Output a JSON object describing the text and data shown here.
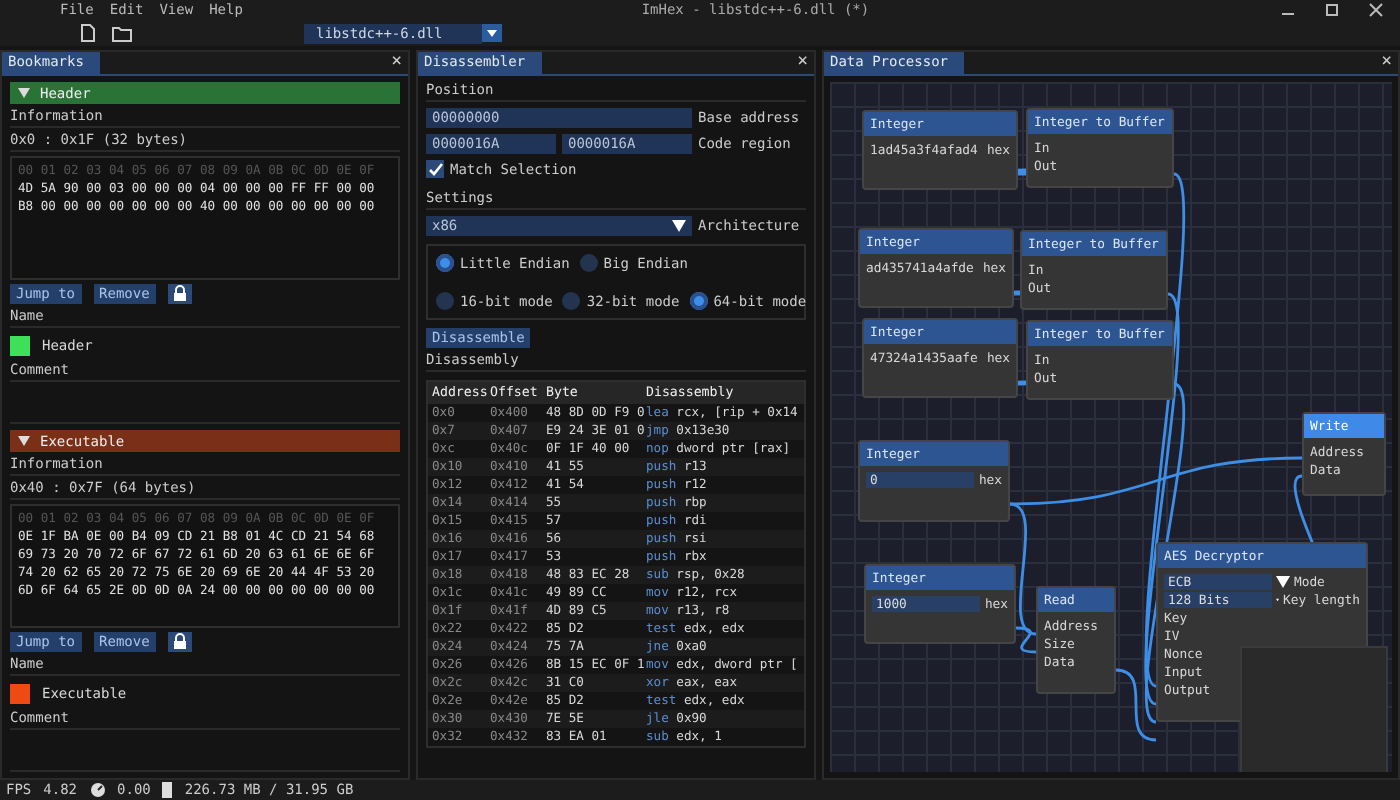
{
  "menu": [
    "File",
    "Edit",
    "View",
    "Help"
  ],
  "window_title": "ImHex - libstdc++-6.dll (*)",
  "file_tab": "libstdc++-6.dll",
  "bookmarks_panel": {
    "title": "Bookmarks",
    "close": "×",
    "bookmarks": [
      {
        "title": "Header",
        "name": "Header",
        "color": "#3ee05a",
        "info_label": "Information",
        "range": "0x0 : 0x1F (32 bytes)",
        "byte_header": "00 01 02 03 04 05 06 07 08 09 0A 0B 0C 0D 0E 0F",
        "byte_rows": [
          "4D 5A 90 00 03 00 00 00 04 00 00 00 FF FF 00 00",
          "B8 00 00 00 00 00 00 00 40 00 00 00 00 00 00 00"
        ],
        "buttons": [
          "Jump to",
          "Remove"
        ],
        "name_label": "Name",
        "comment_label": "Comment"
      },
      {
        "title": "Executable",
        "name": "Executable",
        "color": "#f04a14",
        "info_label": "Information",
        "range": "0x40 : 0x7F (64 bytes)",
        "byte_header": "00 01 02 03 04 05 06 07 08 09 0A 0B 0C 0D 0E 0F",
        "byte_rows": [
          "0E 1F BA 0E 00 B4 09 CD 21 B8 01 4C CD 21 54 68",
          "69 73 20 70 72 6F 67 72 61 6D 20 63 61 6E 6E 6F",
          "74 20 62 65 20 72 75 6E 20 69 6E 20 44 4F 53 20",
          "6D 6F 64 65 2E 0D 0D 0A 24 00 00 00 00 00 00 00"
        ],
        "buttons": [
          "Jump to",
          "Remove"
        ],
        "name_label": "Name",
        "comment_label": "Comment"
      }
    ]
  },
  "disassembler": {
    "title": "Disassembler",
    "close": "×",
    "position_label": "Position",
    "base_address": "00000000",
    "base_address_label": "Base address",
    "code_region": [
      "0000016A",
      "0000016A"
    ],
    "code_region_label": "Code region",
    "match_selection": {
      "label": "Match Selection",
      "checked": true
    },
    "settings_label": "Settings",
    "architecture": {
      "value": "x86",
      "label": "Architecture"
    },
    "endian": [
      {
        "label": "Little Endian",
        "selected": true
      },
      {
        "label": "Big Endian",
        "selected": false
      }
    ],
    "modes": [
      {
        "label": "16-bit mode",
        "selected": false
      },
      {
        "label": "32-bit mode",
        "selected": false
      },
      {
        "label": "64-bit mode",
        "selected": true
      }
    ],
    "disassemble_button": "Disassemble",
    "disassembly_label": "Disassembly",
    "table": {
      "columns": [
        "Address",
        "Offset",
        "Byte",
        "Disassembly"
      ],
      "rows": [
        {
          "address": "0x0",
          "offset": "0x400",
          "bytes": "48 8D 0D F9 0",
          "mnemonic": "lea",
          "operands": "rcx, [rip + 0x14"
        },
        {
          "address": "0x7",
          "offset": "0x407",
          "bytes": "E9 24 3E 01 0",
          "mnemonic": "jmp",
          "operands": "0x13e30"
        },
        {
          "address": "0xc",
          "offset": "0x40c",
          "bytes": "0F 1F 40 00",
          "mnemonic": "nop",
          "operands": "dword ptr [rax]"
        },
        {
          "address": "0x10",
          "offset": "0x410",
          "bytes": "41 55",
          "mnemonic": "push",
          "operands": "r13"
        },
        {
          "address": "0x12",
          "offset": "0x412",
          "bytes": "41 54",
          "mnemonic": "push",
          "operands": "r12"
        },
        {
          "address": "0x14",
          "offset": "0x414",
          "bytes": "55",
          "mnemonic": "push",
          "operands": "rbp"
        },
        {
          "address": "0x15",
          "offset": "0x415",
          "bytes": "57",
          "mnemonic": "push",
          "operands": "rdi"
        },
        {
          "address": "0x16",
          "offset": "0x416",
          "bytes": "56",
          "mnemonic": "push",
          "operands": "rsi"
        },
        {
          "address": "0x17",
          "offset": "0x417",
          "bytes": "53",
          "mnemonic": "push",
          "operands": "rbx"
        },
        {
          "address": "0x18",
          "offset": "0x418",
          "bytes": "48 83 EC 28",
          "mnemonic": "sub",
          "operands": "rsp, 0x28"
        },
        {
          "address": "0x1c",
          "offset": "0x41c",
          "bytes": "49 89 CC",
          "mnemonic": "mov",
          "operands": "r12, rcx"
        },
        {
          "address": "0x1f",
          "offset": "0x41f",
          "bytes": "4D 89 C5",
          "mnemonic": "mov",
          "operands": "r13, r8"
        },
        {
          "address": "0x22",
          "offset": "0x422",
          "bytes": "85 D2",
          "mnemonic": "test",
          "operands": "edx, edx"
        },
        {
          "address": "0x24",
          "offset": "0x424",
          "bytes": "75 7A",
          "mnemonic": "jne",
          "operands": "0xa0"
        },
        {
          "address": "0x26",
          "offset": "0x426",
          "bytes": "8B 15 EC 0F 1",
          "mnemonic": "mov",
          "operands": "edx, dword ptr ["
        },
        {
          "address": "0x2c",
          "offset": "0x42c",
          "bytes": "31 C0",
          "mnemonic": "xor",
          "operands": "eax, eax"
        },
        {
          "address": "0x2e",
          "offset": "0x42e",
          "bytes": "85 D2",
          "mnemonic": "test",
          "operands": "edx, edx"
        },
        {
          "address": "0x30",
          "offset": "0x430",
          "bytes": "7E 5E",
          "mnemonic": "jle",
          "operands": "0x90"
        },
        {
          "address": "0x32",
          "offset": "0x432",
          "bytes": "83 EA 01",
          "mnemonic": "sub",
          "operands": "edx, 1"
        }
      ]
    }
  },
  "data_processor": {
    "title": "Data Processor",
    "close": "×",
    "nodes": [
      {
        "kind": "integer",
        "title": "Integer",
        "value": "1ad45a3f4afad4",
        "unit": "hex",
        "selected": false
      },
      {
        "kind": "int_to_buffer",
        "title": "Integer to Buffer",
        "pins": [
          "In",
          "Out"
        ],
        "selected": false
      },
      {
        "kind": "integer",
        "title": "Integer",
        "value": "ad435741a4afde",
        "unit": "hex",
        "selected": false
      },
      {
        "kind": "int_to_buffer",
        "title": "Integer to Buffer",
        "pins": [
          "In",
          "Out"
        ],
        "selected": false
      },
      {
        "kind": "integer",
        "title": "Integer",
        "value": "47324a1435aafe",
        "unit": "hex",
        "selected": false
      },
      {
        "kind": "int_to_buffer",
        "title": "Integer to Buffer",
        "pins": [
          "In",
          "Out"
        ],
        "selected": false
      },
      {
        "kind": "integer_input",
        "title": "Integer",
        "value": "0",
        "unit": "hex",
        "selected": false
      },
      {
        "kind": "integer_input",
        "title": "Integer",
        "value": "1000",
        "unit": "hex",
        "selected": false
      },
      {
        "kind": "read",
        "title": "Read",
        "pins": [
          "Address",
          "Size",
          "Data"
        ],
        "selected": false
      },
      {
        "kind": "write",
        "title": "Write",
        "pins": [
          "Address",
          "Data"
        ],
        "selected": true
      },
      {
        "kind": "aes",
        "title": "AES Decryptor",
        "options": [
          {
            "value": "ECB",
            "label": "Mode"
          },
          {
            "value": "128 Bits",
            "label": "Key length"
          }
        ],
        "pins": [
          "Key",
          "IV",
          "Nonce",
          "Input",
          "Output"
        ],
        "selected": false
      }
    ]
  },
  "status_bar": {
    "fps_label": "FPS",
    "fps": "4.82",
    "cpu": "0.00",
    "memory": "226.73 MB / 31.95 GB"
  }
}
